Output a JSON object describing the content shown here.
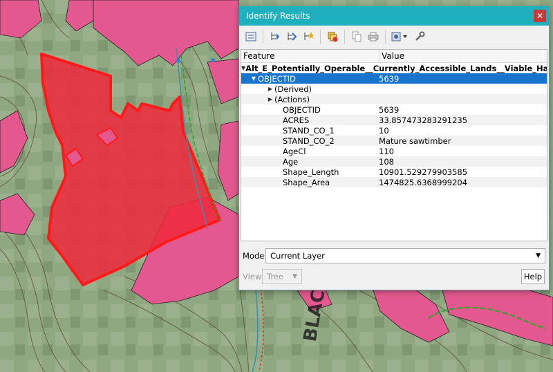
{
  "dialog": {
    "title": "Identify Results",
    "close_glyph": "✕"
  },
  "toolbar": {
    "icons": [
      "expand-tree-icon",
      "expand-all-icon",
      "collapse-all-icon",
      "expand-new-icon",
      "clear-highlight-icon",
      "copy-feature-icon",
      "print-icon",
      "select-mode-icon",
      "settings-icon"
    ]
  },
  "tree": {
    "columns": [
      "Feature",
      "Value"
    ],
    "layer": "Alt_E_Potentially_Operable__Currently_Accessible_Lands__Viable_Harvest...",
    "feature": {
      "label": "OBJECTID",
      "value": "5639"
    },
    "derived": "(Derived)",
    "actions": "(Actions)",
    "attributes": [
      {
        "name": "OBJECTID",
        "value": "5639"
      },
      {
        "name": "ACRES",
        "value": "33.857473283291235"
      },
      {
        "name": "STAND_CO_1",
        "value": "10"
      },
      {
        "name": "STAND_CO_2",
        "value": "Mature sawtimber"
      },
      {
        "name": "AgeCl",
        "value": "110"
      },
      {
        "name": "Age",
        "value": "108"
      },
      {
        "name": "Shape_Length",
        "value": "10901.529279903585"
      },
      {
        "name": "Shape_Area",
        "value": "1474825.6368999204"
      }
    ]
  },
  "mode": {
    "label": "Mode",
    "selected": "Current Layer"
  },
  "view": {
    "label": "View",
    "selected": "Tree"
  },
  "help_label": "Help",
  "map": {
    "labels": [
      "BLACK"
    ],
    "colors": {
      "terrain": "#8fa882",
      "zone": "#e3598f",
      "selection": "#f0283c",
      "contour": "#5a4632",
      "trail": "#2aa52a"
    }
  }
}
